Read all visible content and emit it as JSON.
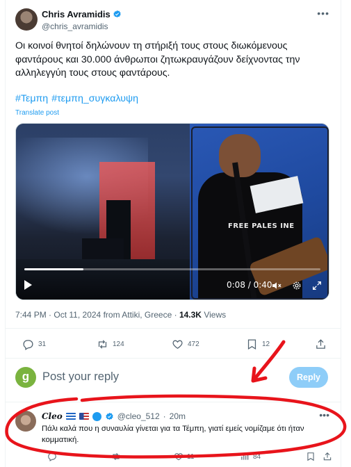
{
  "tweet": {
    "author_name": "Chris Avramidis",
    "author_handle": "@chris_avramidis",
    "text": "Οι κοινοί θνητοί δηλώνουν τη στήριξή τους στους διωκόμενους φαντάρους και 30.000 άνθρωποι ζητωκραυγάζουν δείχνοντας την αλληλεγγύη τους στους φαντάρους.",
    "hashtags": [
      "#Τεμπη",
      "#τεμπη_συγκαλυψη"
    ],
    "translate_label": "Translate post",
    "video": {
      "time": "0:08 / 0:40",
      "progress": 0.2,
      "shirt_text": "FREE PALES INE"
    },
    "meta": {
      "time": "7:44 PM",
      "date": "Oct 11, 2024",
      "location_prefix": "from",
      "location": "Attiki, Greece",
      "views_count": "14.3K",
      "views_label": "Views"
    },
    "actions": {
      "replies": "31",
      "reposts": "124",
      "likes": "472",
      "bookmarks": "12"
    }
  },
  "composer": {
    "avatar_letter": "g",
    "placeholder": "Post your reply",
    "reply_button": "Reply"
  },
  "reply": {
    "author_name": "Cleo",
    "author_handle": "@cleo_512",
    "time_ago": "20m",
    "text": "Πάλι καλά που η συναυλία γίνεται για τα Τέμπη, γιατί εμείς νομίζαμε ότι ήταν κομματική.",
    "actions": {
      "replies": "",
      "reposts": "",
      "likes": "11",
      "views": "84"
    }
  },
  "colors": {
    "accent": "#1d9bf0",
    "annotation": "#e8141b",
    "reply_button_disabled": "#8ecdf8"
  },
  "icons": [
    "verified-icon",
    "more-icon",
    "play-icon",
    "volume-icon",
    "settings-icon",
    "fullscreen-icon",
    "reply-icon",
    "repost-icon",
    "like-icon",
    "bookmark-icon",
    "share-icon",
    "views-icon"
  ]
}
